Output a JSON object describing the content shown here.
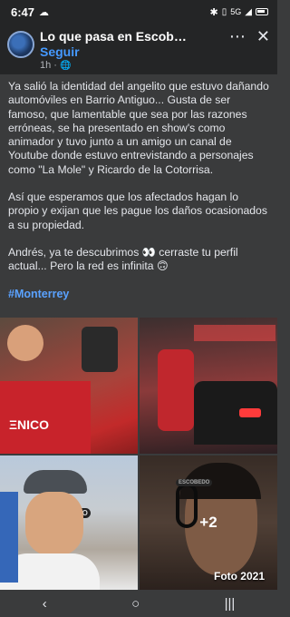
{
  "status": {
    "time": "6:47",
    "network": "5G"
  },
  "header": {
    "page_name": "Lo que pasa en Escob…",
    "follow_label": "Seguir",
    "time_ago": "1h ·"
  },
  "post": {
    "paragraphs": [
      "Ya salió la identidad del angelito que estuvo dañando automóviles en Barrio Antiguo... Gusta de ser famoso, que lamentable que sea por las razones erróneas, se ha presentado en show's como animador y tuvo junto a un amigo un canal de Youtube donde estuvo entrevistando a personajes como \"La Mole\" y Ricardo de la Cotorrisa.",
      "Así que esperamos que los afectados hagan lo propio y exijan que les pague los daños ocasionados a su propiedad.",
      "Andrés, ya te descubrimos 👀 cerraste tu perfil actual... Pero la red es infinita 🙃"
    ],
    "hashtag": "#Monterrey"
  },
  "photos": {
    "more_count": "+2",
    "caption": "Foto 2021",
    "cap_text": "ESCOBEDO",
    "headphone_text": "ESCOBEDO"
  },
  "colors": {
    "link": "#4599ff",
    "background": "#3a3b3c",
    "header_bg": "#242526"
  }
}
